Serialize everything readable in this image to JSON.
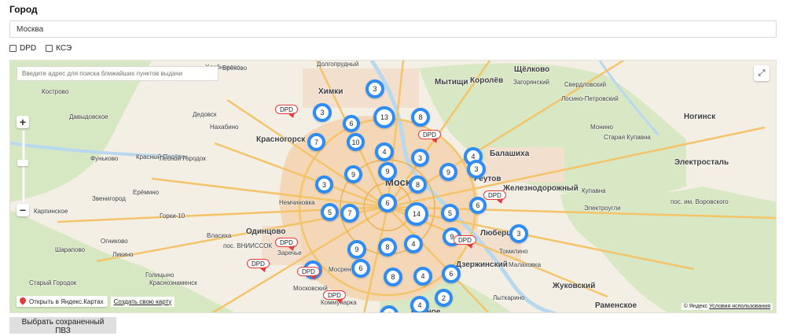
{
  "form": {
    "title": "Город",
    "city_value": "Москва",
    "filters": [
      {
        "label": "DPD",
        "checked": false
      },
      {
        "label": "КСЭ",
        "checked": false
      }
    ]
  },
  "map": {
    "search_placeholder": "Введите адрес для поиска ближайших пунктов выдачи",
    "clusters": [
      {
        "count": "3"
      },
      {
        "count": "3"
      },
      {
        "count": "13"
      },
      {
        "count": "8"
      },
      {
        "count": "6"
      },
      {
        "count": "7"
      },
      {
        "count": "10"
      },
      {
        "count": "4"
      },
      {
        "count": "3"
      },
      {
        "count": "4"
      },
      {
        "count": "9"
      },
      {
        "count": "9"
      },
      {
        "count": "9"
      },
      {
        "count": "3"
      },
      {
        "count": "8"
      },
      {
        "count": "6"
      },
      {
        "count": "3"
      },
      {
        "count": "5"
      },
      {
        "count": "7"
      },
      {
        "count": "14"
      },
      {
        "count": "5"
      },
      {
        "count": "6"
      },
      {
        "count": "9"
      },
      {
        "count": "3"
      },
      {
        "count": "9"
      },
      {
        "count": "8"
      },
      {
        "count": "4"
      },
      {
        "count": "4"
      },
      {
        "count": "6"
      },
      {
        "count": "8"
      },
      {
        "count": "4"
      },
      {
        "count": "6"
      },
      {
        "count": "2"
      },
      {
        "count": "4"
      },
      {
        "count": "4"
      }
    ],
    "pins": [
      {
        "label": "DPD"
      },
      {
        "label": "DPD"
      },
      {
        "label": "DPD"
      },
      {
        "label": "DPD"
      },
      {
        "label": "DPD"
      },
      {
        "label": "DPD"
      },
      {
        "label": "DPD"
      },
      {
        "label": "DPD"
      }
    ],
    "places": [
      {
        "name": "Хлебниково"
      },
      {
        "name": "Долгопрудный"
      },
      {
        "name": "Мытищи"
      },
      {
        "name": "Королёв"
      },
      {
        "name": "Щёлково"
      },
      {
        "name": "Химки"
      },
      {
        "name": "Загорянский"
      },
      {
        "name": "Свердловский"
      },
      {
        "name": "Лосино-Петровский"
      },
      {
        "name": "Дедовск"
      },
      {
        "name": "Нахабино"
      },
      {
        "name": "Красногорск"
      },
      {
        "name": "Монино"
      },
      {
        "name": "Ногинск"
      },
      {
        "name": "Балашиха"
      },
      {
        "name": "Старая Купавна"
      },
      {
        "name": "Электросталь"
      },
      {
        "name": "Реутов"
      },
      {
        "name": "Железнодорожный"
      },
      {
        "name": "Купавна"
      },
      {
        "name": "Москва"
      },
      {
        "name": "Немчиновка"
      },
      {
        "name": "Звенигород"
      },
      {
        "name": "Карпинское"
      },
      {
        "name": "Горки-10"
      },
      {
        "name": "Электроугли"
      },
      {
        "name": "пос. им. Воровского"
      },
      {
        "name": "Власиха"
      },
      {
        "name": "Одинцово"
      },
      {
        "name": "Заречье"
      },
      {
        "name": "пос. ВНИИССОК"
      },
      {
        "name": "Люберцы"
      },
      {
        "name": "Томилино"
      },
      {
        "name": "Дзержинский"
      },
      {
        "name": "Малаховка"
      },
      {
        "name": "Голицыно"
      },
      {
        "name": "Краснознаменск"
      },
      {
        "name": "Мосрентген"
      },
      {
        "name": "Московский"
      },
      {
        "name": "Жуковский"
      },
      {
        "name": "Видное"
      },
      {
        "name": "Раменское"
      },
      {
        "name": "Коммунарка"
      },
      {
        "name": "Лыткарино"
      },
      {
        "name": "Старый Городок"
      },
      {
        "name": "Шарапово"
      },
      {
        "name": "Кострово"
      },
      {
        "name": "Давыдовское"
      },
      {
        "name": "Фуньково"
      },
      {
        "name": "Красный Посёлок"
      },
      {
        "name": "Лесной Городок"
      },
      {
        "name": "Ерёмино"
      },
      {
        "name": "Брёхово"
      },
      {
        "name": "Огниково"
      },
      {
        "name": "Ликино"
      }
    ],
    "open_link": "Открыть в Яндекс.Картах",
    "create_link": "Создать свою карту",
    "copyright_text": "© Яндекс",
    "terms_link": "Условия использования"
  },
  "actions": {
    "save_label": "Выбрать сохраненный ПВЗ"
  },
  "colors": {
    "cluster_ring": "#2f8cf5",
    "pin_border": "#e23b3b",
    "map_bg": "#f4efe4",
    "forest": "#d6e8c1",
    "water": "#b8d8ef",
    "road": "#f3c46a",
    "city": "#f3d7b7"
  }
}
